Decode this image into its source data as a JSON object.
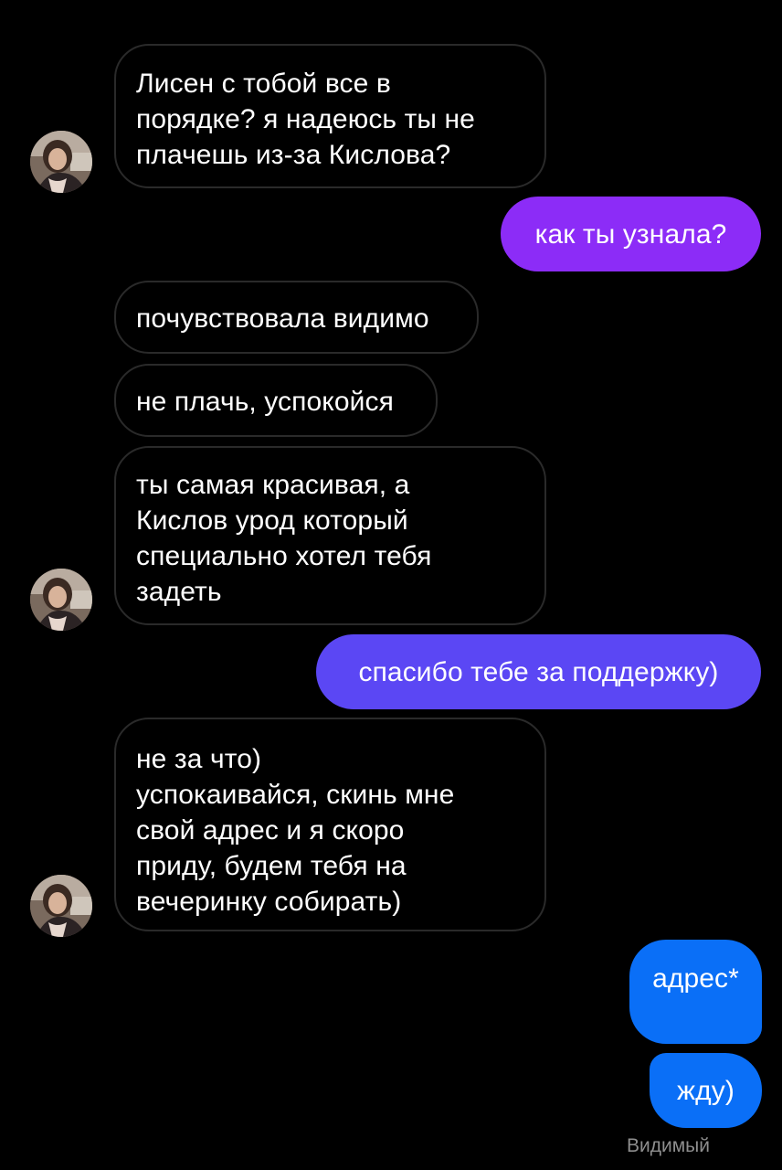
{
  "conversation": {
    "messages": [
      {
        "from": "them",
        "text": "Лисен с тобой все в\nпорядке? я надеюсь ты не\nплачешь из-за Кислова?"
      },
      {
        "from": "me",
        "text": "как ты узнала?"
      },
      {
        "from": "them",
        "text": "почувствовала видимо"
      },
      {
        "from": "them",
        "text": "не плачь, успокойся"
      },
      {
        "from": "them",
        "text": "ты самая красивая, а\nКислов урод который\nспециально хотел тебя\nзадеть"
      },
      {
        "from": "me",
        "text": "спасибо тебе за поддержку)"
      },
      {
        "from": "them",
        "text": "не за что)\nуспокаивайся, скинь мне\nсвой адрес и я скоро\nприду, будем тебя на\nвечеринку собирать)"
      },
      {
        "from": "me",
        "text": "адрес*"
      },
      {
        "from": "me",
        "text": "жду)"
      }
    ],
    "seen_status": "Видимый"
  },
  "colors": {
    "outgoing_purple": "#8c2cf7",
    "outgoing_indigo": "#5b47f4",
    "outgoing_blue": "#0a6ff7",
    "incoming_border": "#2a2a2a",
    "background": "#000000"
  },
  "icons": {
    "contact_avatar": "avatar-photo"
  }
}
